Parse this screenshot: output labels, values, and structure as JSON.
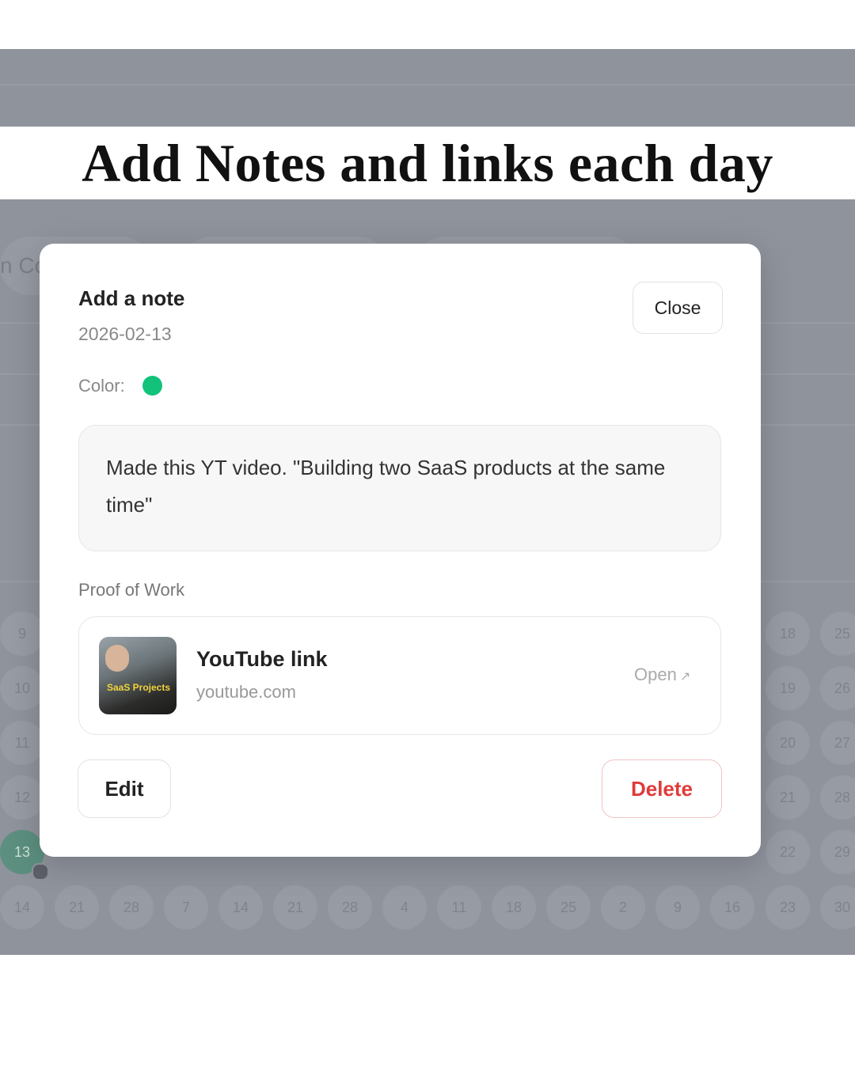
{
  "headline": "Add Notes and links each day",
  "background": {
    "ghost_text": "n Co",
    "left_col_days": [
      "9",
      "10",
      "11",
      "12",
      "13",
      "14"
    ],
    "right_col_a": [
      "18",
      "19",
      "20",
      "21",
      "22",
      "23"
    ],
    "right_col_b": [
      "25",
      "26",
      "27",
      "28",
      "29",
      "30"
    ],
    "bottom_row": [
      "21",
      "28",
      "7",
      "14",
      "21",
      "28",
      "4",
      "11",
      "18",
      "25",
      "2",
      "9",
      "16"
    ],
    "today_color": "#5c8f7f"
  },
  "modal": {
    "title": "Add a note",
    "date": "2026-02-13",
    "close_label": "Close",
    "color_label": "Color:",
    "color_value": "#12c27a",
    "note_text": "Made this YT video. \"Building two SaaS products at the same time\"",
    "proof_label": "Proof of Work",
    "link": {
      "title": "YouTube link",
      "domain": "youtube.com",
      "open_label": "Open",
      "open_icon": "external-arrow-icon",
      "thumbnail_caption": "SaaS Projects"
    },
    "edit_label": "Edit",
    "delete_label": "Delete",
    "delete_color": "#e03b3b"
  }
}
